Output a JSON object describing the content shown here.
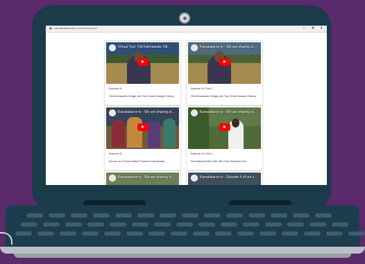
{
  "colors": {
    "background": "#5a2a6a",
    "lid": "#1b3a4a",
    "accent_play": "#ff0000"
  },
  "browser": {
    "url": "kahnawakebutter.com/virtual-tours/",
    "icons": [
      "lock-icon",
      "star-icon",
      "extension-icon",
      "download-icon"
    ]
  },
  "cards": [
    {
      "video_title": "Virtual Tour: Old Kahnawake Vill...",
      "episode": "Episode 01",
      "title": "Old Kahnawake Village with Tour Guide Dwayne Stacey",
      "scene": "field"
    },
    {
      "video_title": "Kanatakaron tv - We are sharing stories wi...",
      "episode": "Episode 01: Part 2",
      "title": "Old Kahnawake Village with Tour Guide Dwayne Stacey",
      "scene": "field"
    },
    {
      "video_title": "Kanatakaron tv - We are sharing stories wi...",
      "episode": "Episode 02",
      "title": "Echoes of a Proud Nation Powwow Kahnawake",
      "scene": "powwow"
    },
    {
      "video_title": "Kanatakaron tv - We are sharing stories wi...",
      "episode": "Episode 03: Part 1",
      "title": "Recreational Bike Path with Host Shawana Dee",
      "scene": "path"
    },
    {
      "video_title": "Kanatakaron tv - We are sharing stories wi...",
      "episode": "",
      "title": "",
      "scene": "path"
    },
    {
      "video_title": "Kanatakaron tv - Episode 4 of our virtual to...",
      "episode": "",
      "title": "",
      "scene": "field"
    }
  ]
}
